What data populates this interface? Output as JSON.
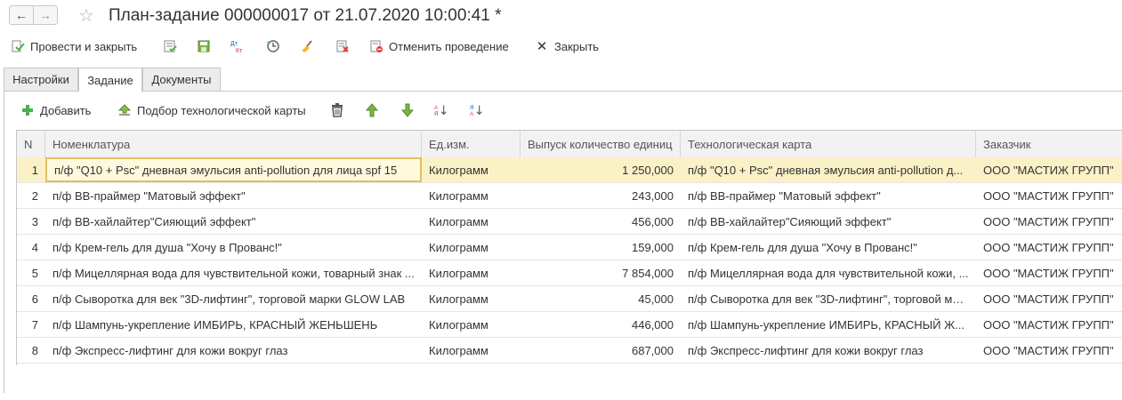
{
  "window": {
    "title": "План-задание 000000017 от 21.07.2020 10:00:41 *",
    "nav_back": "←",
    "nav_forward": "→",
    "favorite_icon": "star-icon"
  },
  "commandbar": {
    "post_and_close": "Провести и закрыть",
    "cancel_posting": "Отменить проведение",
    "close": "Закрыть"
  },
  "tabs": [
    {
      "label": "Настройки",
      "active": false
    },
    {
      "label": "Задание",
      "active": true
    },
    {
      "label": "Документы",
      "active": false
    }
  ],
  "table_toolbar": {
    "add": "Добавить",
    "pick_tech_card": "Подбор технологической карты"
  },
  "table": {
    "columns": [
      "N",
      "Номенклатура",
      "Ед.изм.",
      "Выпуск количество единиц",
      "Технологическая карта",
      "Заказчик"
    ],
    "rows": [
      {
        "n": "1",
        "item": "п/ф \"Q10 + Psc\" дневная эмульсия anti-pollution для лица spf 15",
        "unit": "Килограмм",
        "qty": "1 250,000",
        "card": "п/ф \"Q10 + Psc\" дневная эмульсия anti-pollution д...",
        "customer": "ООО \"МАСТИЖ ГРУПП\""
      },
      {
        "n": "2",
        "item": "п/ф BB-праймер \"Матовый эффект\"",
        "unit": "Килограмм",
        "qty": "243,000",
        "card": "п/ф BB-праймер \"Матовый эффект\"",
        "customer": "ООО \"МАСТИЖ ГРУПП\""
      },
      {
        "n": "3",
        "item": "п/ф BB-хайлайтер\"Сияющий эффект\"",
        "unit": "Килограмм",
        "qty": "456,000",
        "card": "п/ф BB-хайлайтер\"Сияющий эффект\"",
        "customer": "ООО \"МАСТИЖ ГРУПП\""
      },
      {
        "n": "4",
        "item": "п/ф Крем-гель для душа \"Хочу в Прованс!\"",
        "unit": "Килограмм",
        "qty": "159,000",
        "card": "п/ф Крем-гель для душа \"Хочу в Прованс!\"",
        "customer": "ООО \"МАСТИЖ ГРУПП\""
      },
      {
        "n": "5",
        "item": "п/ф Мицеллярная вода для чувствительной кожи, товарный знак ...",
        "unit": "Килограмм",
        "qty": "7 854,000",
        "card": "п/ф Мицеллярная вода для чувствительной кожи, ...",
        "customer": "ООО \"МАСТИЖ ГРУПП\""
      },
      {
        "n": "6",
        "item": "п/ф Сыворотка для век \"3D-лифтинг\", торговой марки GLOW LAB",
        "unit": "Килограмм",
        "qty": "45,000",
        "card": "п/ф Сыворотка для век \"3D-лифтинг\", торговой мар...",
        "customer": "ООО \"МАСТИЖ ГРУПП\""
      },
      {
        "n": "7",
        "item": "п/ф Шампунь-укрепление ИМБИРЬ, КРАСНЫЙ ЖЕНЬШЕНЬ",
        "unit": "Килограмм",
        "qty": "446,000",
        "card": "п/ф Шампунь-укрепление ИМБИРЬ, КРАСНЫЙ Ж...",
        "customer": "ООО \"МАСТИЖ ГРУПП\""
      },
      {
        "n": "8",
        "item": "п/ф Экспресс-лифтинг для кожи вокруг глаз",
        "unit": "Килограмм",
        "qty": "687,000",
        "card": "п/ф Экспресс-лифтинг для кожи вокруг глаз",
        "customer": "ООО \"МАСТИЖ ГРУПП\""
      }
    ]
  },
  "colors": {
    "selected_row": "#fbf1c6",
    "focus_border": "#e2c062",
    "green_icon": "#4caf50"
  }
}
